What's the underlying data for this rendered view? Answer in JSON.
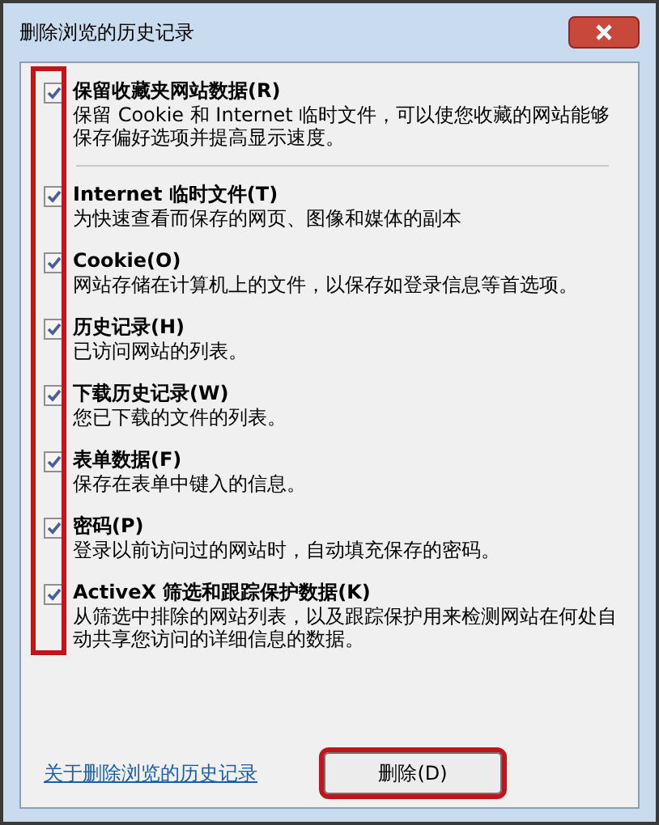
{
  "window": {
    "title": "删除浏览的历史记录"
  },
  "options": [
    {
      "label": "保留收藏夹网站数据(R)",
      "description": "保留 Cookie 和 Internet 临时文件，可以使您收藏的网站能够保存偏好选项并提高显示速度。",
      "checked": true
    },
    {
      "label": "Internet 临时文件(T)",
      "description": "为快速查看而保存的网页、图像和媒体的副本",
      "checked": true
    },
    {
      "label": "Cookie(O)",
      "description": "网站存储在计算机上的文件，以保存如登录信息等首选项。",
      "checked": true
    },
    {
      "label": "历史记录(H)",
      "description": "已访问网站的列表。",
      "checked": true
    },
    {
      "label": "下载历史记录(W)",
      "description": "您已下载的文件的列表。",
      "checked": true
    },
    {
      "label": "表单数据(F)",
      "description": "保存在表单中键入的信息。",
      "checked": true
    },
    {
      "label": "密码(P)",
      "description": "登录以前访问过的网站时，自动填充保存的密码。",
      "checked": true
    },
    {
      "label": "ActiveX 筛选和跟踪保护数据(K)",
      "description": "从筛选中排除的网站列表，以及跟踪保护用来检测网站在何处自动共享您访问的详细信息的数据。",
      "checked": true
    }
  ],
  "footer": {
    "link": "关于删除浏览的历史记录",
    "buttons": [
      "删除(D)"
    ]
  }
}
